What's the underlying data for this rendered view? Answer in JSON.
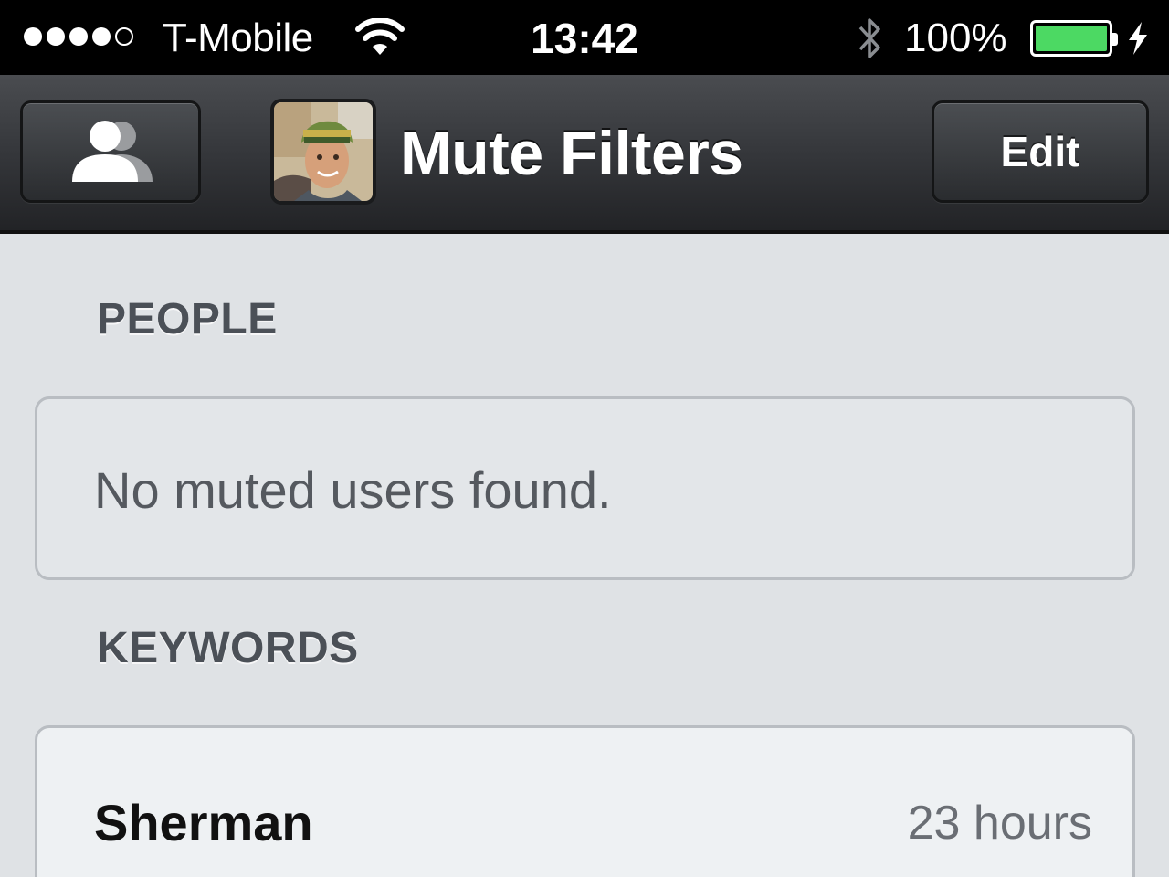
{
  "status_bar": {
    "carrier": "T-Mobile",
    "signal_strength": "4/5",
    "time": "13:42",
    "battery_percent": "100%",
    "battery_level": 1.0,
    "icons": [
      "signal-dots-icon",
      "wifi-icon",
      "bluetooth-icon",
      "battery-icon",
      "charging-bolt-icon"
    ]
  },
  "nav_bar": {
    "title": "Mute Filters",
    "edit_label": "Edit",
    "left_button_icon": "people-icon",
    "avatar_icon": "user-avatar"
  },
  "sections": {
    "people": {
      "header": "PEOPLE",
      "empty_message": "No muted users found."
    },
    "keywords": {
      "header": "KEYWORDS",
      "items": [
        {
          "term": "Sherman",
          "duration": "23 hours"
        }
      ]
    }
  },
  "colors": {
    "status_bar_bg": "#000000",
    "nav_bar_bg": "#2e3034",
    "content_bg": "#dfe2e5",
    "battery_fill": "#4cd963",
    "header_text": "#4b5057"
  }
}
